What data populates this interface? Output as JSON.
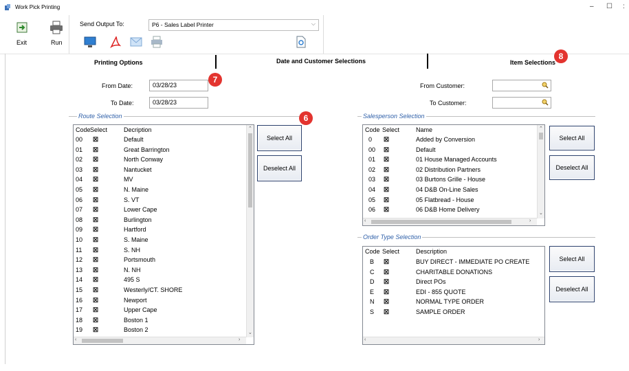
{
  "window": {
    "title": "Work Pick Printing",
    "minimize": "–",
    "maximize": "☐",
    "more": ":"
  },
  "toolbar": {
    "exit_label": "Exit",
    "run_label": "Run",
    "send_output_label": "Send Output To:",
    "printer_value": "P6 - Sales Label Printer"
  },
  "tabs": {
    "printing_options": "Printing Options",
    "date_customer": "Date and Customer Selections",
    "item_selections": "Item Selections"
  },
  "dates": {
    "from_label": "From Date:",
    "from_value": "03/28/23",
    "to_label": "To Date:",
    "to_value": "03/28/23"
  },
  "customer": {
    "from_label": "From Customer:",
    "to_label": "To Customer:"
  },
  "badges": {
    "b7": "7",
    "b6": "6",
    "b8": "8"
  },
  "route": {
    "title": "Route Selection",
    "headers": {
      "code": "Code",
      "select": "Select",
      "desc": "Decription"
    },
    "rows": [
      {
        "code": "00",
        "desc": "Default"
      },
      {
        "code": "01",
        "desc": "Great Barrington"
      },
      {
        "code": "02",
        "desc": "North Conway"
      },
      {
        "code": "03",
        "desc": "Nantucket"
      },
      {
        "code": "04",
        "desc": "MV"
      },
      {
        "code": "05",
        "desc": "N. Maine"
      },
      {
        "code": "06",
        "desc": "S. VT"
      },
      {
        "code": "07",
        "desc": "Lower Cape"
      },
      {
        "code": "08",
        "desc": "Burlington"
      },
      {
        "code": "09",
        "desc": "Hartford"
      },
      {
        "code": "10",
        "desc": "S. Maine"
      },
      {
        "code": "11",
        "desc": "S. NH"
      },
      {
        "code": "12",
        "desc": "Portsmouth"
      },
      {
        "code": "13",
        "desc": "N. NH"
      },
      {
        "code": "14",
        "desc": "495 S"
      },
      {
        "code": "15",
        "desc": "Westerly/CT. SHORE"
      },
      {
        "code": "16",
        "desc": "Newport"
      },
      {
        "code": "17",
        "desc": "Upper Cape"
      },
      {
        "code": "18",
        "desc": "Boston 1"
      },
      {
        "code": "19",
        "desc": "Boston 2"
      }
    ],
    "select_all": "Select All",
    "deselect_all": "Deselect All"
  },
  "salesperson": {
    "title": "Salesperson Selection",
    "headers": {
      "code": "Code",
      "select": "Select",
      "name": "Name"
    },
    "rows": [
      {
        "code": "0",
        "name": "Added by Conversion"
      },
      {
        "code": "00",
        "name": "Default"
      },
      {
        "code": "01",
        "name": "01 House Managed Accounts"
      },
      {
        "code": "02",
        "name": "02 Distribution Partners"
      },
      {
        "code": "03",
        "name": "03 Burtons Grille - House"
      },
      {
        "code": "04",
        "name": "04 D&B On-Line Sales"
      },
      {
        "code": "05",
        "name": "05 Flatbread - House"
      },
      {
        "code": "06",
        "name": "06 D&B Home Delivery"
      }
    ],
    "select_all": "Select All",
    "deselect_all": "Deselect All"
  },
  "order_type": {
    "title": "Order Type Selection",
    "headers": {
      "code": "Code",
      "select": "Select",
      "desc": "Description"
    },
    "rows": [
      {
        "code": "B",
        "desc": "BUY DIRECT - IMMEDIATE PO CREATE"
      },
      {
        "code": "C",
        "desc": "CHARITABLE DONATIONS"
      },
      {
        "code": "D",
        "desc": "Direct POs"
      },
      {
        "code": "E",
        "desc": "EDI - 855 QUOTE"
      },
      {
        "code": "N",
        "desc": "NORMAL TYPE ORDER"
      },
      {
        "code": "S",
        "desc": "SAMPLE ORDER"
      }
    ],
    "select_all": "Select All",
    "deselect_all": "Deselect All"
  },
  "checkbox_glyph": "☒",
  "icons": {
    "exit": "exit-icon",
    "run": "printer-icon",
    "screen": "monitor-icon",
    "pdf": "pdf-icon",
    "email": "email-icon",
    "printer": "printer-icon",
    "preview": "preview-icon",
    "search": "magnifier-icon"
  },
  "colors": {
    "group_title": "#2e5fa8",
    "badge": "#e3342f",
    "button_border": "#2a3f6b"
  }
}
